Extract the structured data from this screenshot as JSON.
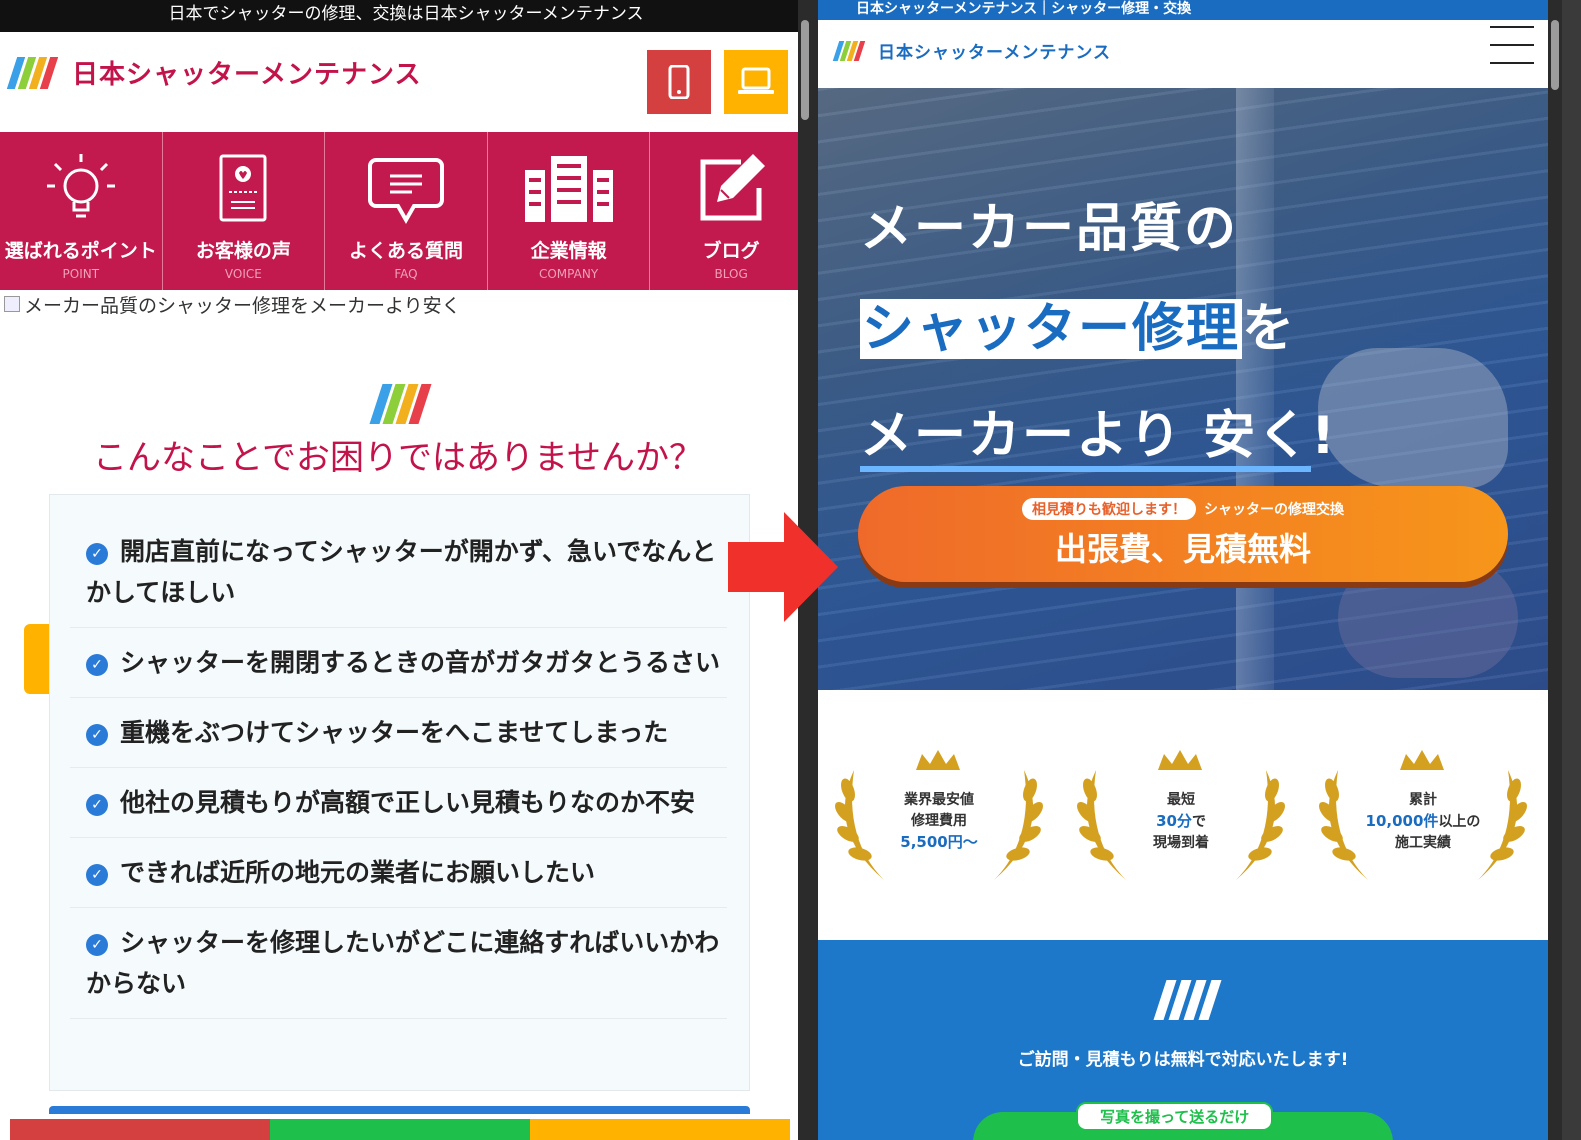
{
  "left": {
    "top_title": "日本でシャッターの修理、交換は日本シャッターメンテナンス",
    "logo_text": "日本シャッターメンテナンス",
    "logo_stripe_colors": [
      "#3aa0e8",
      "#8ccf3a",
      "#f2b01e",
      "#e8404a"
    ],
    "buttons": {
      "phone_icon": "phone-icon",
      "pc_icon": "laptop-icon"
    },
    "nav": [
      {
        "label": "選ばれるポイント",
        "sub": "POINT",
        "icon": "lightbulb-icon"
      },
      {
        "label": "お客様の声",
        "sub": "VOICE",
        "icon": "customer-voice-icon"
      },
      {
        "label": "よくある質問",
        "sub": "FAQ",
        "icon": "speech-bubble-icon"
      },
      {
        "label": "企業情報",
        "sub": "COMPANY",
        "icon": "building-icon"
      },
      {
        "label": "ブログ",
        "sub": "BLOG",
        "icon": "pencil-note-icon"
      }
    ],
    "broken_image_alt": "メーカー品質のシャッター修理をメーカーより安く",
    "section_title": "こんなことでお困りではありませんか？",
    "troubles": [
      "開店直前になってシャッターが開かず、急いでなんとかしてほしい",
      "シャッターを開閉するときの音がガタガタとうるさい",
      "重機をぶつけてシャッターをへこませてしまった",
      "他社の見積もりが高額で正しい見積もりなのか不安",
      "できれば近所の地元の業者にお願いしたい",
      "シャッターを修理したいがどこに連絡すればいいかわからない"
    ],
    "colors": {
      "brand": "#c2144a",
      "check": "#2a7bd8",
      "bottom_buttons": [
        "#d44040",
        "#1fbf4c",
        "#ffb300"
      ]
    }
  },
  "right": {
    "top_title": "日本シャッターメンテナンス｜シャッター修理・交換",
    "logo_text": "日本シャッターメンテナンス",
    "hero": {
      "line1": "メーカー品質の",
      "line2_highlight": "シャッター修理",
      "line2_rest": "を",
      "line3_underline": "メーカーより 安く",
      "line3_rest": "!"
    },
    "cta": {
      "pill": "相見積りも歓迎します！",
      "small": "シャッターの修理交換",
      "big": "出張費、見積無料"
    },
    "awards": [
      {
        "line1": "業界最安値",
        "line2": "修理費用",
        "line3": "5,500円〜",
        "highlight": "5,500円〜"
      },
      {
        "line1": "最短",
        "line2_blue": "30分",
        "line2_rest": "で",
        "line3": "現場到着"
      },
      {
        "line1": "累計",
        "line2_blue": "10,000件",
        "line2_rest": "以上の",
        "line3": "施工実績"
      }
    ],
    "blue_section_msg": "ご訪問・見積もりは無料で対応いたします!",
    "green_label": "写真を撮って送るだけ",
    "colors": {
      "brand": "#1a6cc0",
      "cta": "#ef6a2a",
      "green": "#1fbf4c",
      "gold": "#d4a020"
    }
  },
  "arrow_icon": "right-arrow-icon"
}
